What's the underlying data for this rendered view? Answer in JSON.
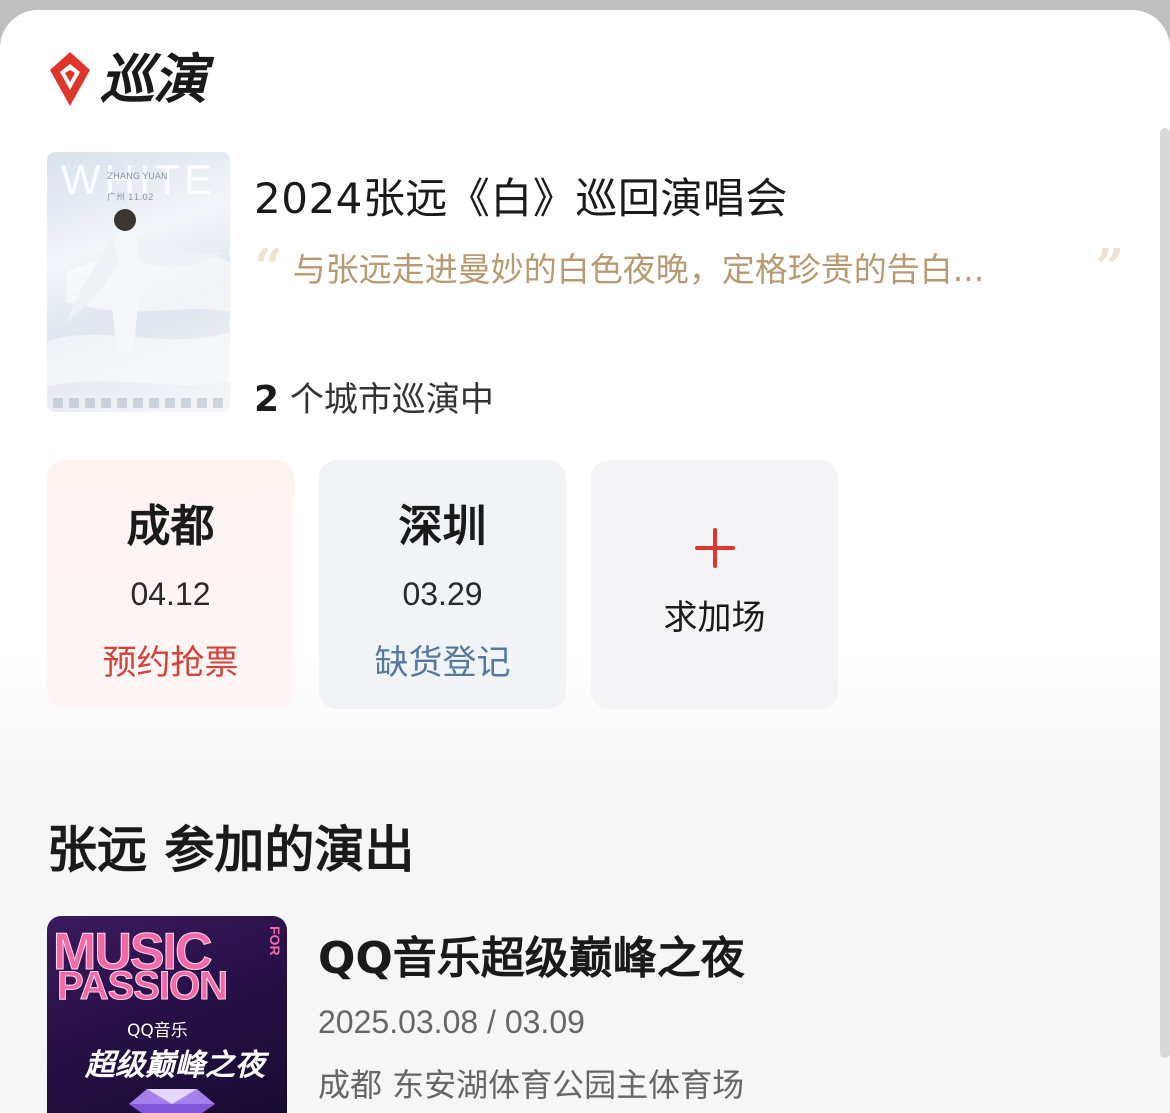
{
  "brand": {
    "name": "巡演",
    "logo_icon": "diamond-location-icon",
    "accent": "#e0352b"
  },
  "tour": {
    "title": "2024张远《白》巡回演唱会",
    "poster_word": "WHITE",
    "poster_artist": "ZHANG YUAN",
    "poster_city_date": "广州  11.02",
    "quote": "与张远走进曼妙的白色夜晚，定格珍贵的告白...",
    "quote_open": "“",
    "quote_close": "”",
    "cities_num": "2",
    "cities_text": "个城市巡演中"
  },
  "cities": [
    {
      "name": "成都",
      "date": "04.12",
      "status": "预约抢票",
      "status_color": "#d5413b"
    },
    {
      "name": "深圳",
      "date": "03.29",
      "status": "缺货登记",
      "status_color": "#5678a0"
    }
  ],
  "add_show": {
    "label": "求加场",
    "icon": "plus-icon"
  },
  "section": {
    "title": "张远  参加的演出"
  },
  "show": {
    "title": "QQ音乐超级巅峰之夜",
    "date": "2025.03.08 / 03.09",
    "venue": "成都 东安湖体育公园主体育场",
    "thumb_music": "MUSIC",
    "thumb_passion": "PASSION",
    "thumb_for": "FOR",
    "thumb_brand": "QQ音乐",
    "thumb_night": "超级巅峰之夜"
  }
}
